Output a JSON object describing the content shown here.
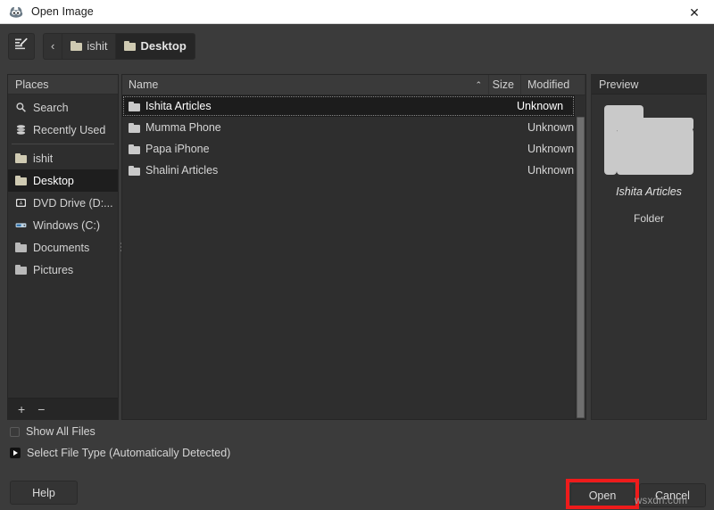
{
  "window": {
    "title": "Open Image",
    "icon": "gimp-wilber-icon",
    "close_label": "✕"
  },
  "toolbar": {
    "type_location_icon": "edit-location-icon",
    "back_label": "‹",
    "breadcrumbs": [
      {
        "label": "ishit",
        "icon": "folder-icon",
        "active": false
      },
      {
        "label": "Desktop",
        "icon": "folder-icon",
        "active": true
      }
    ]
  },
  "places": {
    "header": "Places",
    "items": [
      {
        "label": "Search",
        "icon": "search-icon",
        "selected": false
      },
      {
        "label": "Recently Used",
        "icon": "recent-icon",
        "selected": false
      },
      {
        "label": "ishit",
        "icon": "folder-icon",
        "selected": false
      },
      {
        "label": "Desktop",
        "icon": "folder-icon",
        "selected": true
      },
      {
        "label": "DVD Drive (D:...",
        "icon": "optical-drive-icon",
        "selected": false
      },
      {
        "label": "Windows (C:)",
        "icon": "hard-drive-icon",
        "selected": false
      },
      {
        "label": "Documents",
        "icon": "folder-icon",
        "selected": false
      },
      {
        "label": "Pictures",
        "icon": "folder-icon",
        "selected": false
      }
    ],
    "add_label": "+",
    "remove_label": "−"
  },
  "filelist": {
    "columns": {
      "name": "Name",
      "size": "Size",
      "modified": "Modified",
      "sort_caret": "⌃"
    },
    "rows": [
      {
        "name": "Ishita Articles",
        "size": "",
        "modified": "Unknown",
        "icon": "folder-icon",
        "selected": true
      },
      {
        "name": "Mumma Phone",
        "size": "",
        "modified": "Unknown",
        "icon": "folder-icon",
        "selected": false
      },
      {
        "name": "Papa iPhone",
        "size": "",
        "modified": "Unknown",
        "icon": "folder-icon",
        "selected": false
      },
      {
        "name": "Shalini Articles",
        "size": "",
        "modified": "Unknown",
        "icon": "folder-icon",
        "selected": false
      }
    ]
  },
  "preview": {
    "header": "Preview",
    "icon": "large-folder-icon",
    "name": "Ishita Articles",
    "type": "Folder"
  },
  "options": {
    "show_all_files": {
      "label": "Show All Files",
      "checked": false
    },
    "select_file_type": {
      "label": "Select File Type (Automatically Detected)",
      "expanded": false
    }
  },
  "footer": {
    "help_label": "Help",
    "open_label": "Open",
    "cancel_label": "Cancel"
  },
  "annotation": {
    "highlight_color": "#ee1b1b",
    "highlight_target": "Open"
  },
  "watermark": {
    "text": "wsxdn.com"
  }
}
